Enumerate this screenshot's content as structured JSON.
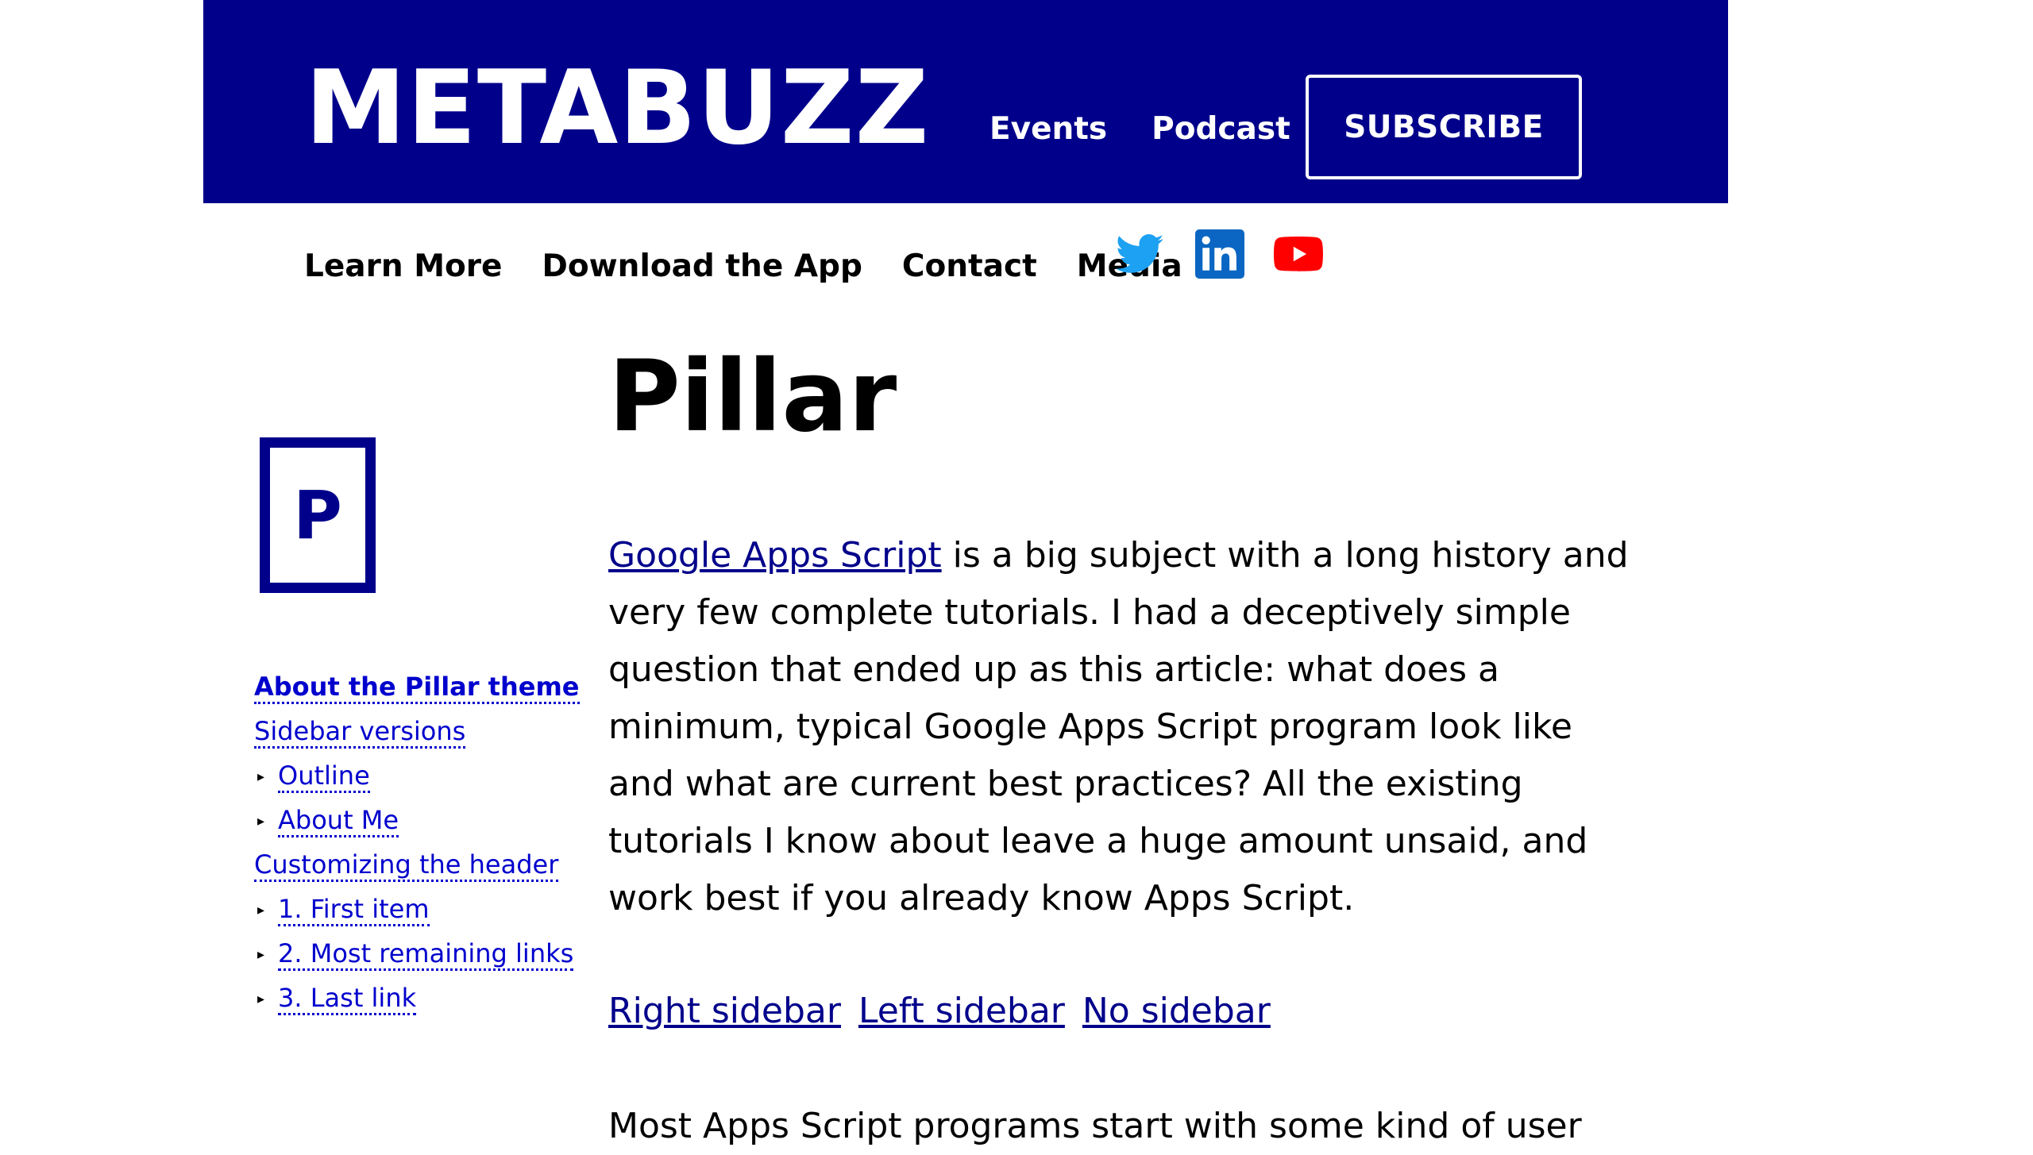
{
  "header": {
    "site_title": "METABUZZ",
    "nav": [
      {
        "label": "Events"
      },
      {
        "label": "Podcast"
      }
    ],
    "subscribe_label": "SUBSCRIBE",
    "background_color": "#00008b"
  },
  "sub_nav": {
    "items": [
      {
        "label": "Learn More"
      },
      {
        "label": "Download the App"
      },
      {
        "label": "Contact"
      },
      {
        "label": "Media"
      }
    ],
    "social_icons": [
      "twitter-icon",
      "linkedin-icon",
      "youtube-icon"
    ],
    "colors": {
      "twitter": "#1da1f2",
      "linkedin": "#0a66c2",
      "youtube": "#ff0000"
    }
  },
  "sidebar": {
    "logo_letter": "P",
    "toc": [
      {
        "label": "About the Pillar theme",
        "level": 0,
        "active": true
      },
      {
        "label": "Sidebar versions",
        "level": 0
      },
      {
        "label": "Outline",
        "level": 1
      },
      {
        "label": "About Me",
        "level": 1
      },
      {
        "label": "Customizing the header",
        "level": 0
      },
      {
        "label": "1. First item",
        "level": 1
      },
      {
        "label": "2. Most remaining links",
        "level": 1
      },
      {
        "label": "3. Last link",
        "level": 1
      }
    ],
    "link_color": "#0000cd"
  },
  "main": {
    "title": "Pillar",
    "intro_link": "Google Apps Script",
    "intro_text": " is a big subject with a long history and very few complete tutorials. I had a deceptively simple question that ended up as this article: what does a minimum, typical Google Apps Script program look like and what are current best practices? All the existing tutorials I know about leave a huge amount unsaid, and work best if you already know Apps Script.",
    "variant_links": [
      {
        "label": "Right sidebar"
      },
      {
        "label": "Left sidebar"
      },
      {
        "label": "No sidebar"
      }
    ],
    "para2_text": "Most Apps Script programs start with some kind of user"
  }
}
